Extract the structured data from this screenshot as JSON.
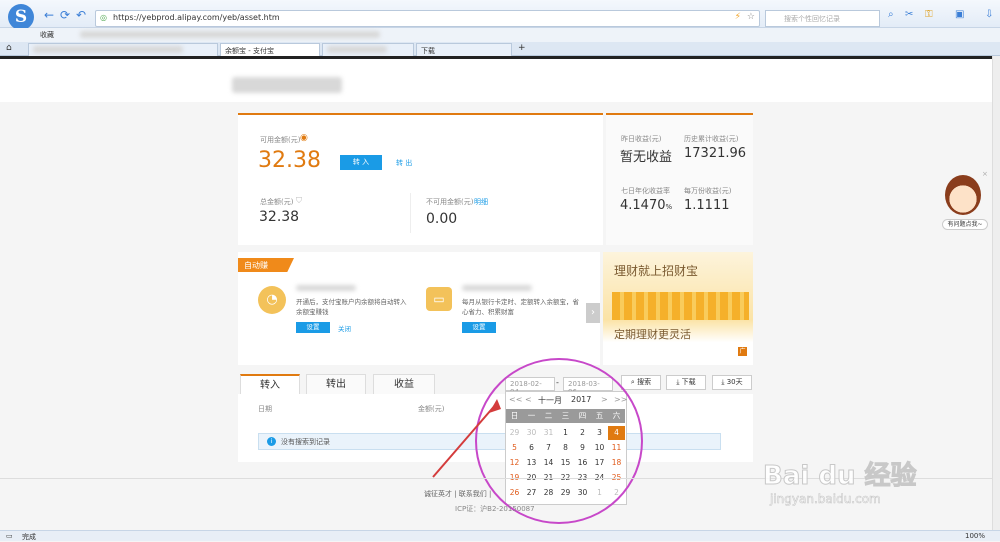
{
  "browser": {
    "url": "https://yebprod.alipay.com/yeb/asset.htm",
    "search_placeholder": "搜索个性回忆记录",
    "favorites_label": "收藏",
    "tabs": [
      {
        "label": "余额宝 - 支付宝"
      },
      {
        "label": "下载"
      }
    ],
    "status_left": "完成",
    "zoom": "100%"
  },
  "account": {
    "available_label": "可用金额(元)",
    "available_value": "32.38",
    "transfer_in": "转 入",
    "transfer_out": "转 出",
    "total_label": "总金额(元)",
    "total_value": "32.38",
    "unavailable_label": "不可用金额(元)",
    "unavailable_link": "明细",
    "unavailable_value": "0.00",
    "yesterday_label": "昨日收益(元)",
    "yesterday_value": "暂无收益",
    "history_label": "历史累计收益(元)",
    "history_value": "17321.96",
    "seven_day_label": "七日年化收益率",
    "seven_day_value": "4.1470",
    "seven_day_unit": "%",
    "per_10k_label": "每万份收益(元)",
    "per_10k_value": "1.1111"
  },
  "auto": {
    "badge": "自动赚",
    "item1_text": "开通后，支付宝账户内余额将自动转入余额宝赚钱",
    "item1_btn": "设置",
    "item1_link": "关闭",
    "item2_text": "每月从银行卡定时、定额转入余额宝，省心省力、积累财富",
    "item2_btn": "设置"
  },
  "banner": {
    "title": "理财就上招财宝",
    "subtitle": "定期理财更灵活",
    "corner": "广"
  },
  "records": {
    "tabs": [
      "转入",
      "转出",
      "收益"
    ],
    "date_from": "2018-02-04",
    "date_sep": "-",
    "date_to": "2018-03-06",
    "search_btn": "搜索",
    "download_btn": "下载",
    "days_btn": "30天",
    "col_date": "日期",
    "col_amount": "金额(元)",
    "empty_msg": "没有搜索到记录"
  },
  "calendar": {
    "prev_year": "<<",
    "prev_month": "<",
    "month": "十一月",
    "year": "2017",
    "next_month": ">",
    "next_year": ">>",
    "weekdays": [
      "日",
      "一",
      "二",
      "三",
      "四",
      "五",
      "六"
    ],
    "weeks": [
      [
        "29",
        "30",
        "31",
        "1",
        "2",
        "3",
        "4"
      ],
      [
        "5",
        "6",
        "7",
        "8",
        "9",
        "10",
        "11"
      ],
      [
        "12",
        "13",
        "14",
        "15",
        "16",
        "17",
        "18"
      ],
      [
        "19",
        "20",
        "21",
        "22",
        "23",
        "24",
        "25"
      ],
      [
        "26",
        "27",
        "28",
        "29",
        "30",
        "1",
        "2"
      ]
    ],
    "selected": "4"
  },
  "footer": {
    "links": "诚征英才 | 联系我们 | ",
    "icp": "ICP证：沪B2-20150087"
  },
  "helper": {
    "label": "有问题点我~"
  },
  "watermark": {
    "brand": "Bai du 经验",
    "url": "jingyan.baidu.com"
  },
  "colors": {
    "accent_orange": "#e07a10",
    "link_blue": "#1a9be6",
    "annotation_magenta": "#c748c9"
  }
}
